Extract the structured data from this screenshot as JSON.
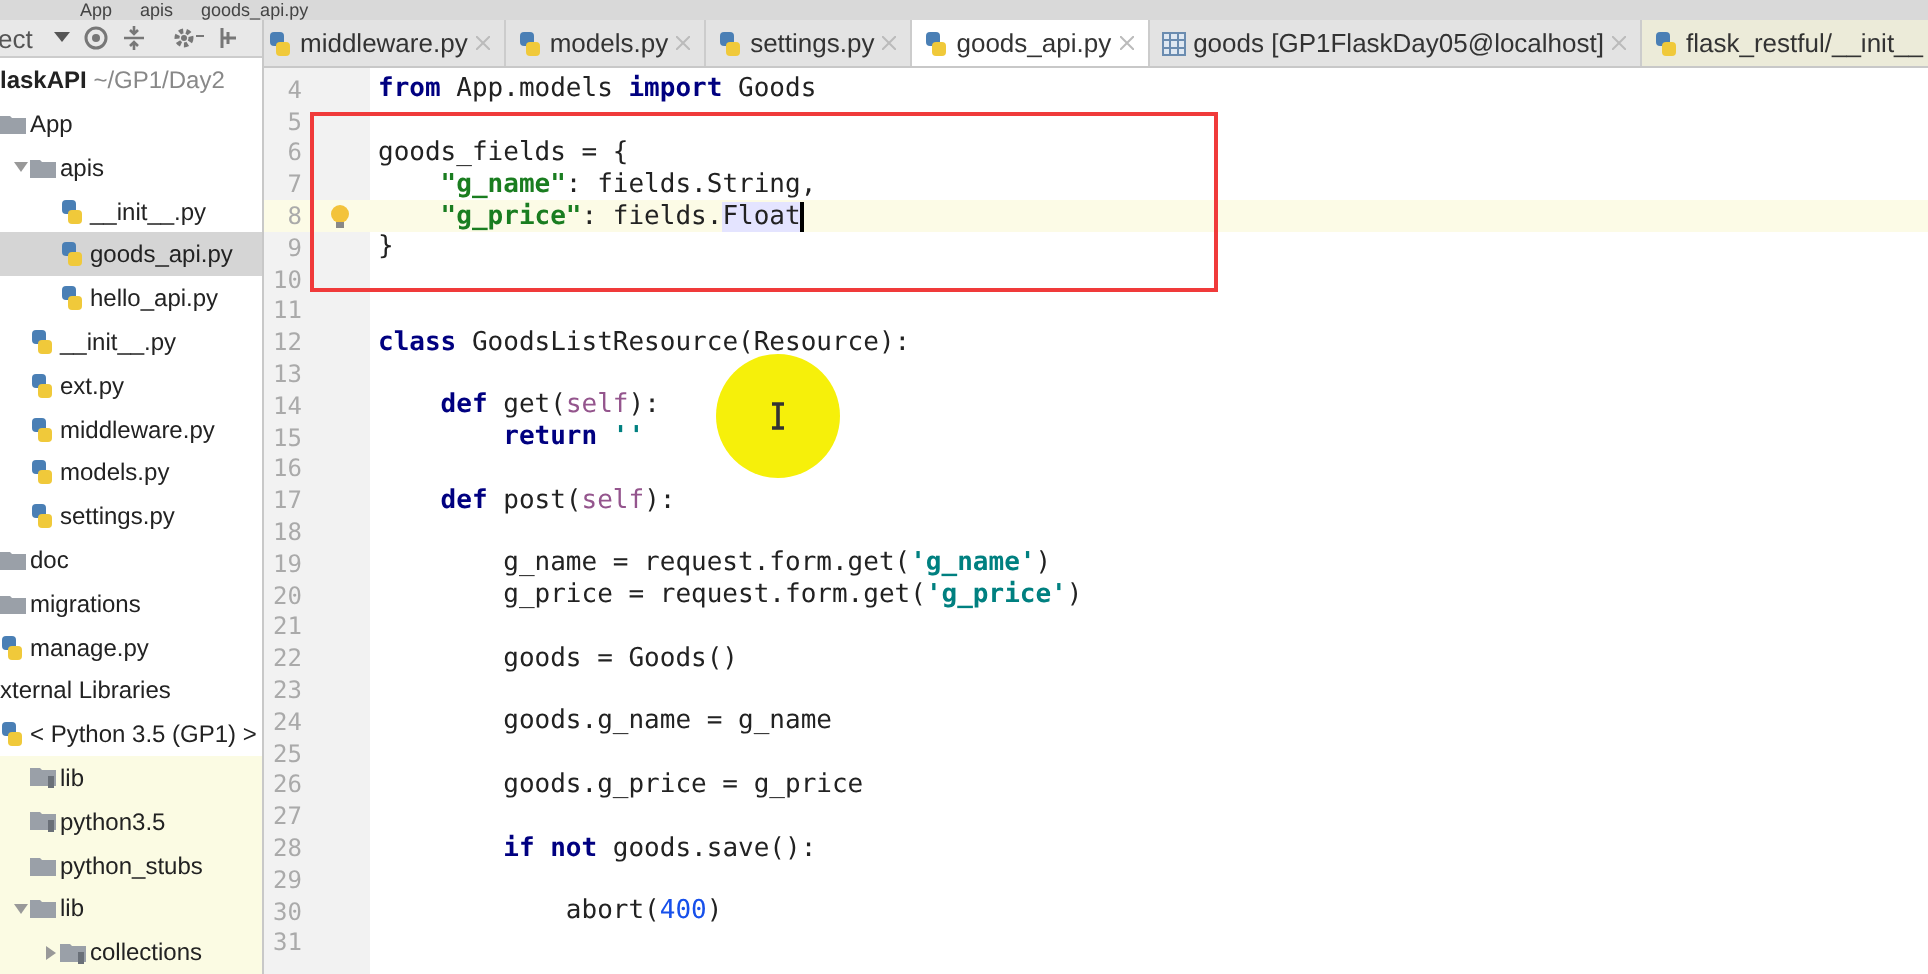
{
  "breadcrumb": [
    "App",
    "apis",
    "goods_api.py"
  ],
  "project_panel": {
    "title": "ect",
    "tree": [
      {
        "label": "laskAPI",
        "path": "~/GP1/Day2",
        "kind": "root",
        "expanded": true,
        "selected": false,
        "library": false,
        "children": [
          {
            "label": "App",
            "kind": "folder",
            "expanded": true,
            "selected": false,
            "library": false,
            "children": [
              {
                "label": "apis",
                "kind": "folder",
                "expanded": true,
                "selected": false,
                "library": false,
                "children": [
                  {
                    "label": "__init__.py",
                    "kind": "python-file",
                    "selected": false,
                    "library": false
                  },
                  {
                    "label": "goods_api.py",
                    "kind": "python-file",
                    "selected": true,
                    "library": false
                  },
                  {
                    "label": "hello_api.py",
                    "kind": "python-file",
                    "selected": false,
                    "library": false
                  }
                ]
              },
              {
                "label": "__init__.py",
                "kind": "python-file",
                "selected": false,
                "library": false
              },
              {
                "label": "ext.py",
                "kind": "python-file",
                "selected": false,
                "library": false
              },
              {
                "label": "middleware.py",
                "kind": "python-file",
                "selected": false,
                "library": false
              },
              {
                "label": "models.py",
                "kind": "python-file",
                "selected": false,
                "library": false
              },
              {
                "label": "settings.py",
                "kind": "python-file",
                "selected": false,
                "library": false
              }
            ]
          },
          {
            "label": "doc",
            "kind": "folder",
            "selected": false,
            "library": false
          },
          {
            "label": "migrations",
            "kind": "folder",
            "selected": false,
            "library": false
          },
          {
            "label": "manage.py",
            "kind": "python-file",
            "selected": false,
            "library": false
          }
        ]
      },
      {
        "label": "xternal Libraries",
        "kind": "root",
        "expanded": true,
        "selected": false,
        "library": false,
        "children": [
          {
            "label": "< Python 3.5 (GP1) >",
            "kind": "python-file",
            "expanded": true,
            "selected": false,
            "library": false,
            "children": [
              {
                "label": "lib",
                "kind": "library",
                "selected": false,
                "library": true
              },
              {
                "label": "python3.5",
                "kind": "library",
                "selected": false,
                "library": true
              },
              {
                "label": "python_stubs",
                "kind": "folder",
                "selected": false,
                "library": true
              },
              {
                "label": "lib",
                "kind": "folder",
                "expanded": true,
                "selected": false,
                "library": true,
                "children": [
                  {
                    "label": "collections",
                    "kind": "library",
                    "expanded": false,
                    "selected": false,
                    "library": true
                  }
                ]
              }
            ]
          }
        ]
      }
    ]
  },
  "tabs": [
    {
      "label": "middleware.py",
      "kind": "python-file",
      "selected": false
    },
    {
      "label": "models.py",
      "kind": "python-file",
      "selected": false
    },
    {
      "label": "settings.py",
      "kind": "python-file",
      "selected": false
    },
    {
      "label": "goods_api.py",
      "kind": "python-file",
      "selected": true
    },
    {
      "label": "goods [GP1FlaskDay05@localhost]",
      "kind": "table",
      "selected": false
    },
    {
      "label": "flask_restful/__init__",
      "kind": "python-file",
      "selected": false
    }
  ],
  "editor": {
    "lines": [
      {
        "number": "4",
        "current": false,
        "tokens": [
          {
            "kind": "keyword",
            "text": "from"
          },
          {
            "kind": "plain",
            "text": " App.models "
          },
          {
            "kind": "keyword",
            "text": "import"
          },
          {
            "kind": "plain",
            "text": " Goods"
          }
        ]
      },
      {
        "number": "5",
        "current": false
      },
      {
        "number": "6",
        "current": false,
        "tokens": [
          {
            "kind": "plain",
            "text": "goods_fields = {"
          }
        ]
      },
      {
        "number": "7",
        "current": false,
        "tokens": [
          {
            "kind": "key",
            "text": "    \"g_name\""
          },
          {
            "kind": "plain",
            "text": ": fields.String,"
          }
        ]
      },
      {
        "number": "8",
        "current": true,
        "tokens": [
          {
            "kind": "key",
            "text": "    \"g_price\""
          },
          {
            "kind": "plain",
            "text": ": fields."
          },
          {
            "kind": "selection",
            "text": "Float"
          }
        ]
      },
      {
        "number": "9",
        "current": false,
        "tokens": [
          {
            "kind": "plain",
            "text": "}"
          }
        ]
      },
      {
        "number": "10",
        "current": false
      },
      {
        "number": "11",
        "current": false
      },
      {
        "number": "12",
        "current": false,
        "tokens": [
          {
            "kind": "keyword",
            "text": "class"
          },
          {
            "kind": "plain",
            "text": " GoodsListResource(Resource):"
          }
        ]
      },
      {
        "number": "13",
        "current": false
      },
      {
        "number": "14",
        "current": false,
        "tokens": [
          {
            "kind": "keyword",
            "text": "    def"
          },
          {
            "kind": "plain",
            "text": " get("
          },
          {
            "kind": "self",
            "text": "self"
          },
          {
            "kind": "plain",
            "text": "):"
          }
        ]
      },
      {
        "number": "15",
        "current": false,
        "tokens": [
          {
            "kind": "keyword",
            "text": "        return"
          },
          {
            "kind": "string",
            "text": " ''"
          }
        ]
      },
      {
        "number": "16",
        "current": false
      },
      {
        "number": "17",
        "current": false,
        "tokens": [
          {
            "kind": "keyword",
            "text": "    def"
          },
          {
            "kind": "plain",
            "text": " post("
          },
          {
            "kind": "self",
            "text": "self"
          },
          {
            "kind": "plain",
            "text": "):"
          }
        ]
      },
      {
        "number": "18",
        "current": false
      },
      {
        "number": "19",
        "current": false,
        "tokens": [
          {
            "kind": "plain",
            "text": "        g_name = request.form.get("
          },
          {
            "kind": "string",
            "text": "'g_name'"
          },
          {
            "kind": "plain",
            "text": ")"
          }
        ]
      },
      {
        "number": "20",
        "current": false,
        "tokens": [
          {
            "kind": "plain",
            "text": "        g_price = request.form.get("
          },
          {
            "kind": "string",
            "text": "'g_price'"
          },
          {
            "kind": "plain",
            "text": ")"
          }
        ]
      },
      {
        "number": "21",
        "current": false
      },
      {
        "number": "22",
        "current": false,
        "tokens": [
          {
            "kind": "plain",
            "text": "        goods = Goods()"
          }
        ]
      },
      {
        "number": "23",
        "current": false
      },
      {
        "number": "24",
        "current": false,
        "tokens": [
          {
            "kind": "plain",
            "text": "        goods.g_name = g_name"
          }
        ]
      },
      {
        "number": "25",
        "current": false
      },
      {
        "number": "26",
        "current": false,
        "tokens": [
          {
            "kind": "plain",
            "text": "        goods.g_price = g_price"
          }
        ]
      },
      {
        "number": "27",
        "current": false
      },
      {
        "number": "28",
        "current": false,
        "tokens": [
          {
            "kind": "keyword",
            "text": "        if not"
          },
          {
            "kind": "plain",
            "text": " goods.save():"
          }
        ]
      },
      {
        "number": "29",
        "current": false
      },
      {
        "number": "30",
        "current": false,
        "tokens": [
          {
            "kind": "plain",
            "text": "            abort("
          },
          {
            "kind": "number",
            "text": "400"
          },
          {
            "kind": "plain",
            "text": ")"
          }
        ]
      },
      {
        "number": "31",
        "current": false
      }
    ]
  }
}
